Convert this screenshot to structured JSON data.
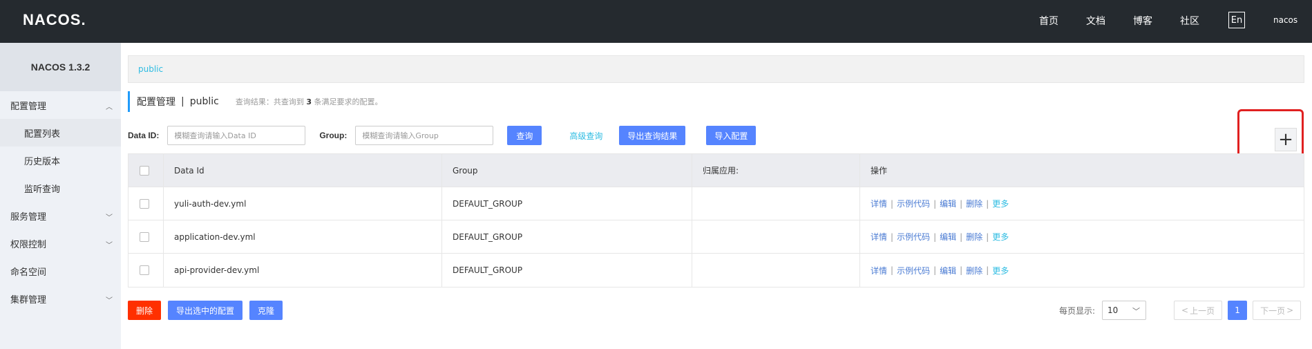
{
  "header": {
    "logo": "NACOS.",
    "nav": [
      "首页",
      "文档",
      "博客",
      "社区"
    ],
    "lang": "En",
    "user": "nacos"
  },
  "sidebar": {
    "version": "NACOS 1.3.2",
    "items": [
      {
        "label": "配置管理",
        "arrow": "up"
      },
      {
        "label": "配置列表"
      },
      {
        "label": "历史版本"
      },
      {
        "label": "监听查询"
      },
      {
        "label": "服务管理",
        "arrow": "down"
      },
      {
        "label": "权限控制",
        "arrow": "down"
      },
      {
        "label": "命名空间"
      },
      {
        "label": "集群管理",
        "arrow": "down"
      }
    ]
  },
  "breadcrumb": "public",
  "title": {
    "main": "配置管理",
    "sep": "|",
    "namespace": "public",
    "hint_prefix": "查询结果：共查询到",
    "hint_count": "3",
    "hint_suffix": "条满足要求的配置。"
  },
  "filters": {
    "data_id_label": "Data ID:",
    "data_id_placeholder": "模糊查询请输入Data ID",
    "group_label": "Group:",
    "group_placeholder": "模糊查询请输入Group",
    "search_btn": "查询",
    "advanced_link": "高级查询",
    "export_btn": "导出查询结果",
    "import_btn": "导入配置"
  },
  "add_button": "+",
  "table": {
    "headers": [
      "Data Id",
      "Group",
      "归属应用:",
      "操作"
    ],
    "rows": [
      {
        "data_id": "yuli-auth-dev.yml",
        "group": "DEFAULT_GROUP",
        "app": ""
      },
      {
        "data_id": "application-dev.yml",
        "group": "DEFAULT_GROUP",
        "app": ""
      },
      {
        "data_id": "api-provider-dev.yml",
        "group": "DEFAULT_GROUP",
        "app": ""
      }
    ],
    "ops": {
      "detail": "详情",
      "sample": "示例代码",
      "edit": "编辑",
      "delete": "删除",
      "more": "更多",
      "sep": "|"
    }
  },
  "bottom": {
    "delete_btn": "删除",
    "export_selected_btn": "导出选中的配置",
    "clone_btn": "克隆"
  },
  "pager": {
    "label": "每页显示:",
    "size": "10",
    "prev": "上一页",
    "page": "1",
    "next": "下一页"
  },
  "colors": {
    "topbar": "#252a2f",
    "primary": "#5584ff",
    "link": "#2ebce2",
    "danger": "#ff3000",
    "highlight": "#e02020"
  }
}
